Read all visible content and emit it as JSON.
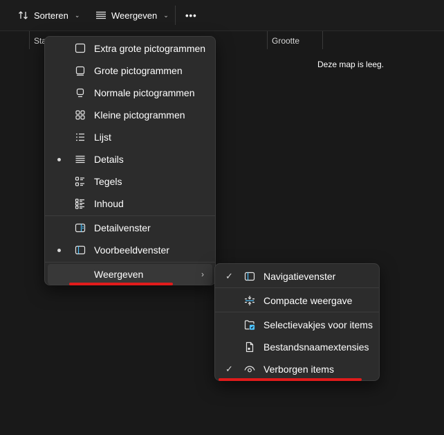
{
  "toolbar": {
    "sort_label": "Sorteren",
    "view_label": "Weergeven",
    "more_label": "•••",
    "sort_icon": "sort-arrows-icon",
    "view_icon": "lines-icon",
    "chevron_icon": "chevron-down-icon"
  },
  "columns": {
    "status_label": "Sta",
    "size_label": "Grootte"
  },
  "empty_message": "Deze map is leeg.",
  "view_menu": {
    "items": [
      {
        "label": "Extra grote pictogrammen",
        "icon": "extra-large-icons-icon",
        "selected": false
      },
      {
        "label": "Grote pictogrammen",
        "icon": "large-icons-icon",
        "selected": false
      },
      {
        "label": "Normale pictogrammen",
        "icon": "medium-icons-icon",
        "selected": false
      },
      {
        "label": "Kleine pictogrammen",
        "icon": "small-icons-icon",
        "selected": false
      },
      {
        "label": "Lijst",
        "icon": "list-icon",
        "selected": false
      },
      {
        "label": "Details",
        "icon": "details-icon",
        "selected": true
      },
      {
        "label": "Tegels",
        "icon": "tiles-icon",
        "selected": false
      },
      {
        "label": "Inhoud",
        "icon": "content-icon",
        "selected": false
      },
      {
        "label": "Detailvenster",
        "icon": "details-pane-icon",
        "selected": false
      },
      {
        "label": "Voorbeeldvenster",
        "icon": "preview-pane-icon",
        "selected": true
      },
      {
        "label": "Weergeven",
        "icon": "",
        "selected": false
      }
    ]
  },
  "show_submenu": {
    "items": [
      {
        "label": "Navigatievenster",
        "icon": "navigation-pane-icon",
        "checked": true
      },
      {
        "label": "Compacte weergave",
        "icon": "compact-view-icon",
        "checked": false
      },
      {
        "label": "Selectievakjes voor items",
        "icon": "item-checkboxes-icon",
        "checked": false
      },
      {
        "label": "Bestandsnaamextensies",
        "icon": "file-extensions-icon",
        "checked": false
      },
      {
        "label": "Verborgen items",
        "icon": "hidden-items-eye-icon",
        "checked": true
      }
    ]
  },
  "colors": {
    "accent_blue": "#4cc2ff",
    "underline_red": "#e01b1b",
    "menu_bg": "#2c2c2c"
  }
}
